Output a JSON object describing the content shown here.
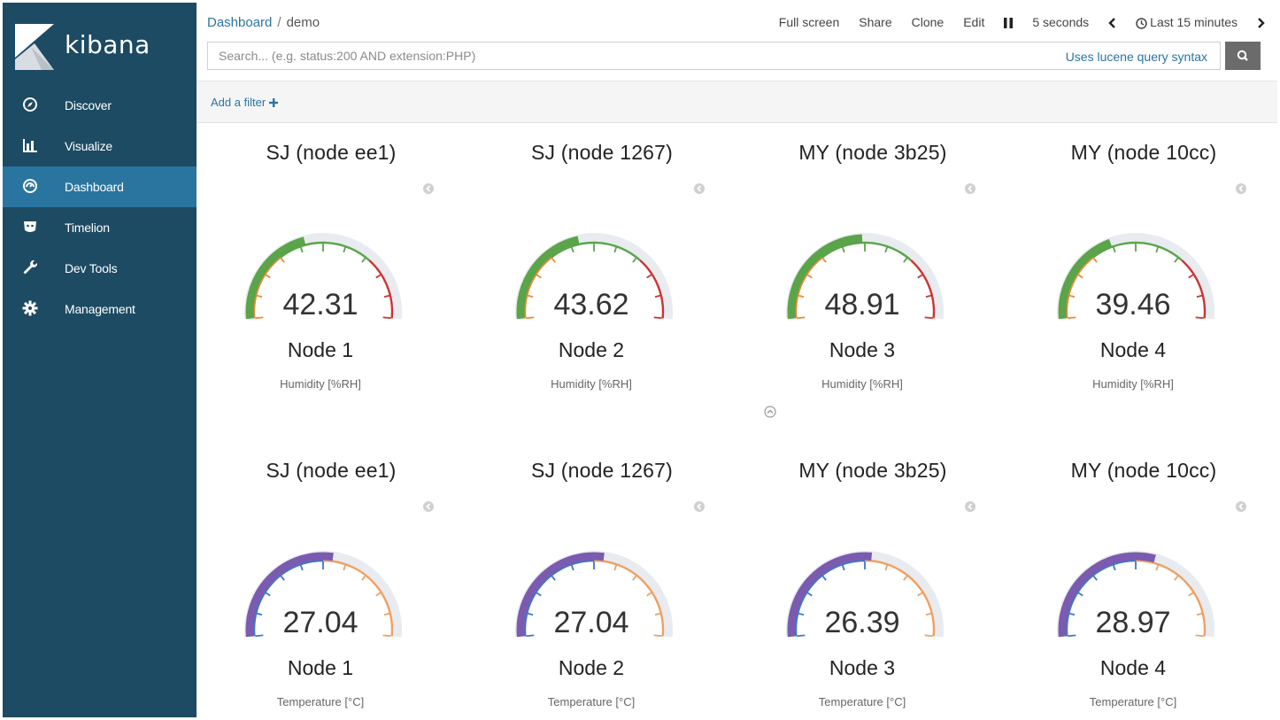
{
  "app": {
    "name": "kibana"
  },
  "nav": {
    "items": [
      {
        "label": "Discover",
        "icon": "compass-icon",
        "active": false
      },
      {
        "label": "Visualize",
        "icon": "bar-chart-icon",
        "active": false
      },
      {
        "label": "Dashboard",
        "icon": "dashboard-icon",
        "active": true
      },
      {
        "label": "Timelion",
        "icon": "timelion-icon",
        "active": false
      },
      {
        "label": "Dev Tools",
        "icon": "wrench-icon",
        "active": false
      },
      {
        "label": "Management",
        "icon": "gear-icon",
        "active": false
      }
    ]
  },
  "breadcrumb": {
    "root": "Dashboard",
    "separator": "/",
    "current": "demo"
  },
  "topmenu": {
    "full_screen": "Full screen",
    "share": "Share",
    "clone": "Clone",
    "edit": "Edit",
    "refresh_interval": "5 seconds",
    "time_range": "Last 15 minutes"
  },
  "search": {
    "placeholder": "Search... (e.g. status:200 AND extension:PHP)",
    "value": "",
    "syntax_hint": "Uses lucene query syntax"
  },
  "filterbar": {
    "add_filter": "Add a filter"
  },
  "colors": {
    "sidebar": "#1d4b63",
    "active": "#2a75a0",
    "humidity_green": "#5aa44a",
    "humidity_orange": "#e88a3a",
    "humidity_red": "#cc3333",
    "temp_purple": "#7a5bb0",
    "temp_blue": "#3c78c8",
    "temp_orange": "#f0a060",
    "track": "#e8ebef"
  },
  "humidity_panels": [
    {
      "title": "SJ (node ee1)",
      "value": "42.31",
      "value_num": 42.31,
      "label": "Node 1",
      "metric": "Humidity [%RH]"
    },
    {
      "title": "SJ (node 1267)",
      "value": "43.62",
      "value_num": 43.62,
      "label": "Node 2",
      "metric": "Humidity [%RH]"
    },
    {
      "title": "MY (node 3b25)",
      "value": "48.91",
      "value_num": 48.91,
      "label": "Node 3",
      "metric": "Humidity [%RH]"
    },
    {
      "title": "MY (node 10cc)",
      "value": "39.46",
      "value_num": 39.46,
      "label": "Node 4",
      "metric": "Humidity [%RH]"
    }
  ],
  "temperature_panels": [
    {
      "title": "SJ (node ee1)",
      "value": "27.04",
      "value_num": 27.04,
      "label": "Node 1",
      "metric": "Temperature [°C]"
    },
    {
      "title": "SJ (node 1267)",
      "value": "27.04",
      "value_num": 27.04,
      "label": "Node 2",
      "metric": "Temperature [°C]"
    },
    {
      "title": "MY (node 3b25)",
      "value": "26.39",
      "value_num": 26.39,
      "label": "Node 3",
      "metric": "Temperature [°C]"
    },
    {
      "title": "MY (node 10cc)",
      "value": "28.97",
      "value_num": 28.97,
      "label": "Node 4",
      "metric": "Temperature [°C]"
    }
  ]
}
